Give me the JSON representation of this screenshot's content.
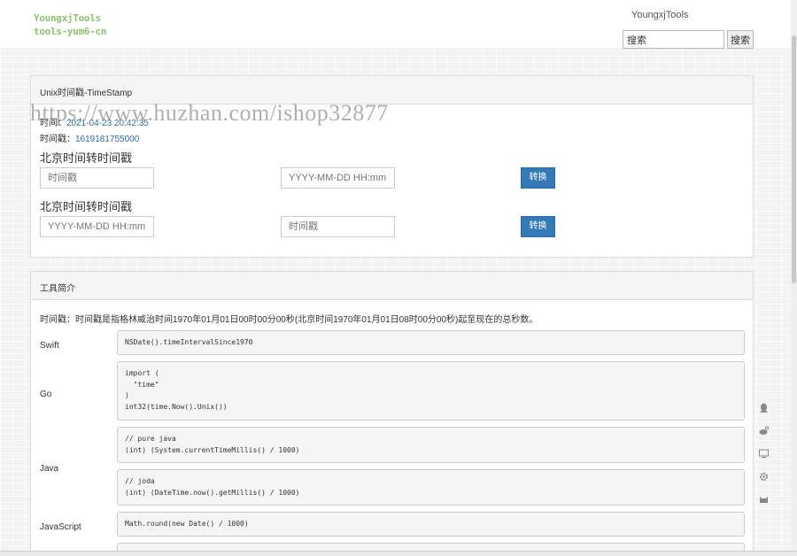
{
  "header": {
    "logo_line1": "YoungxjTools",
    "logo_line2": "tools-yum6-cn",
    "site_name": "YoungxjTools",
    "search_placeholder": "搜索",
    "search_button": "搜索"
  },
  "timestamp_panel": {
    "title": "Unix时间戳-TimeStamp",
    "time_label": "时间：",
    "time_value": "2021-04-23 20:42:35",
    "ts_label": "时间戳：",
    "ts_value": "1619181755000",
    "section1_title": "北京时间转时间戳",
    "section1_input1_placeholder": "时间戳",
    "section1_input2_placeholder": "YYYY-MM-DD HH:mm:",
    "section1_button": "转换",
    "section2_title": "北京时间转时间戳",
    "section2_input1_placeholder": "YYYY-MM-DD HH:mm:",
    "section2_input2_placeholder": "时间戳",
    "section2_button": "转换"
  },
  "intro_panel": {
    "title": "工具简介",
    "description": "时间戳：时间戳是指格林威治时间1970年01月01日00时00分00秒(北京时间1970年01月01日08时00分00秒)起至现在的总秒数。",
    "languages": [
      {
        "name": "Swift",
        "code": "NSDate().timeIntervalSince1970"
      },
      {
        "name": "Go",
        "code": "import (\n  \"time\"\n)\nint32(time.Now().Unix())"
      },
      {
        "name": "Java",
        "code1": "// pure java\n(int) (System.currentTimeMillis() / 1000)",
        "code2": "// joda\n(int) (DateTime.now().getMillis() / 1000)"
      },
      {
        "name": "JavaScript",
        "code": "Math.round(new Date() / 1000)"
      }
    ]
  },
  "watermark": "https://www.huzhan.com/ishop32877",
  "side_icons": [
    "qq-icon",
    "weibo-icon",
    "monitor-icon",
    "gear-icon",
    "cat-icon"
  ]
}
